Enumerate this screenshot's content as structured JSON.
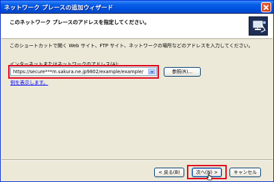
{
  "window": {
    "title": "ネットワーク プレースの追加ウィザード"
  },
  "header": {
    "title": "このネットワーク プレースのアドレスを指定してください。",
    "icon": "network-wizard-icon"
  },
  "body": {
    "description": "このショートカットで開く Web サイト、FTP サイト、ネットワークの場所などのアドレスを入力してください。",
    "address_label": "インターネットまたはネットワークのアドレス(A):",
    "address_value": "https://secure***m.sakura.ne.jp9802/example/example/",
    "browse_label": "参照(R)...",
    "example_link": "例を表示します。"
  },
  "footer": {
    "back_label": "< 戻る(B)",
    "next_label": "次へ(N) >",
    "cancel_label": "キャンセル"
  },
  "colors": {
    "highlight": "#E3001B",
    "titlebar": "#0054E3",
    "dialog_bg": "#ECE9D8"
  }
}
